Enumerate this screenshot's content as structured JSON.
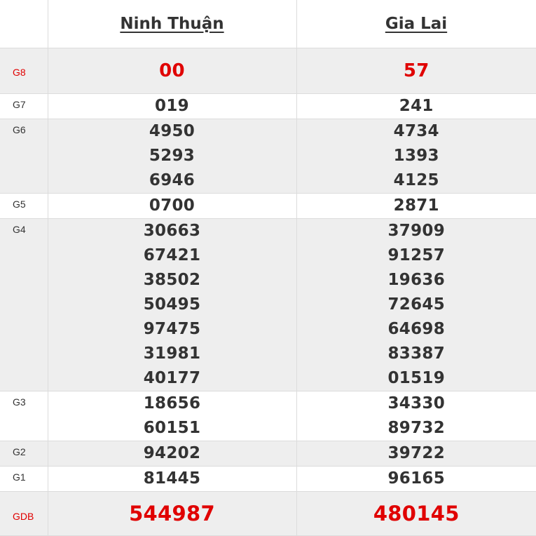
{
  "provinces": [
    "Ninh Thuận",
    "Gia Lai"
  ],
  "rows": [
    {
      "label": "G8",
      "red": true,
      "shaded": true,
      "values": [
        [
          "00"
        ],
        [
          "57"
        ]
      ]
    },
    {
      "label": "G7",
      "red": false,
      "shaded": false,
      "values": [
        [
          "019"
        ],
        [
          "241"
        ]
      ]
    },
    {
      "label": "G6",
      "red": false,
      "shaded": true,
      "values": [
        [
          "4950",
          "5293",
          "6946"
        ],
        [
          "4734",
          "1393",
          "4125"
        ]
      ]
    },
    {
      "label": "G5",
      "red": false,
      "shaded": false,
      "values": [
        [
          "0700"
        ],
        [
          "2871"
        ]
      ]
    },
    {
      "label": "G4",
      "red": false,
      "shaded": true,
      "values": [
        [
          "30663",
          "67421",
          "38502",
          "50495",
          "97475",
          "31981",
          "40177"
        ],
        [
          "37909",
          "91257",
          "19636",
          "72645",
          "64698",
          "83387",
          "01519"
        ]
      ]
    },
    {
      "label": "G3",
      "red": false,
      "shaded": false,
      "values": [
        [
          "18656",
          "60151"
        ],
        [
          "34330",
          "89732"
        ]
      ]
    },
    {
      "label": "G2",
      "red": false,
      "shaded": true,
      "values": [
        [
          "94202"
        ],
        [
          "39722"
        ]
      ]
    },
    {
      "label": "G1",
      "red": false,
      "shaded": false,
      "values": [
        [
          "81445"
        ],
        [
          "96165"
        ]
      ]
    },
    {
      "label": "GDB",
      "red": true,
      "shaded": true,
      "values": [
        [
          "544987"
        ],
        [
          "480145"
        ]
      ]
    }
  ],
  "colors": {
    "highlight": "#e00000",
    "text": "#333333",
    "shade": "#eeeeee",
    "border": "#dcdcdc"
  }
}
